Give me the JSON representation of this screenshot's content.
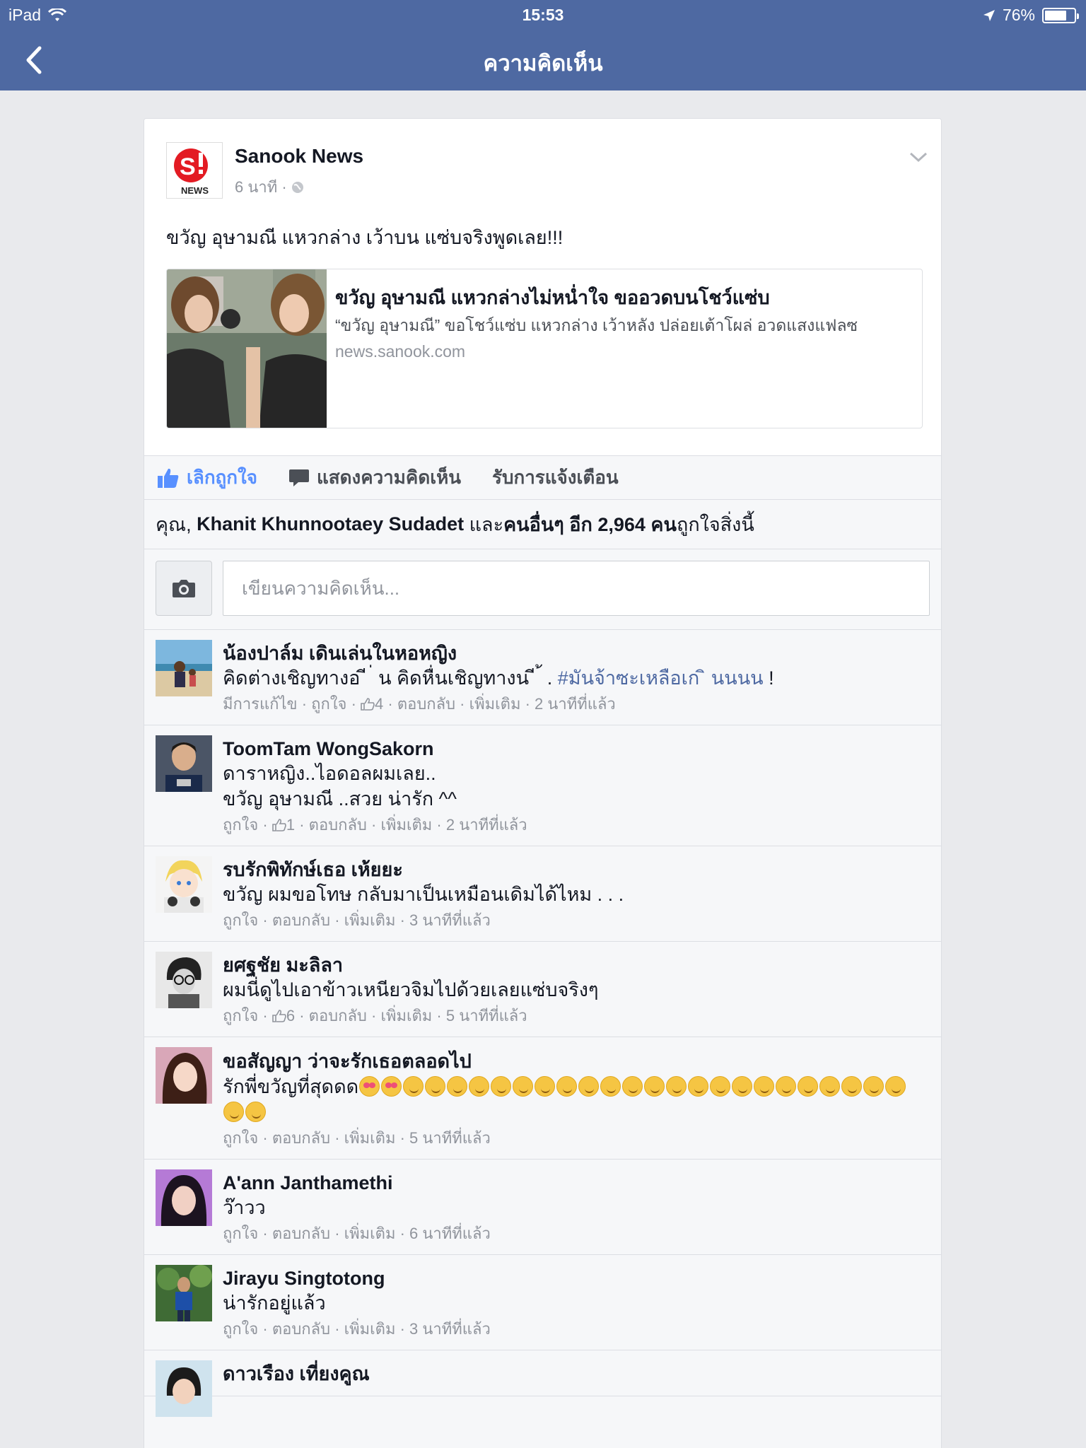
{
  "status_bar": {
    "device": "iPad",
    "time": "15:53",
    "battery": "76%",
    "battery_level": 0.76
  },
  "nav": {
    "title": "ความคิดเห็น"
  },
  "post": {
    "page_name": "Sanook News",
    "logo_text": "NEWS",
    "time": "6 นาที ·",
    "text": "ขวัญ อุษามณี แหวกล่าง เว้าบน แซ่บจริงพูดเลย!!!",
    "link": {
      "title": "ขวัญ อุษามณี แหวกล่างไม่หน่ำใจ ขออวดบนโชว์แซ่บ",
      "description": "“ขวัญ อุษามณี” ขอโชว์แซ่บ แหวกล่าง เว้าหลัง ปล่อยเต้าโผล่ อวดแสงแฟลซ",
      "domain": "news.sanook.com"
    }
  },
  "actions": {
    "like": "เลิกถูกใจ",
    "comment": "แสดงความคิดเห็น",
    "notify": "รับการแจ้งเตือน"
  },
  "likes": {
    "you": "คุณ,",
    "friend": "Khanit Khunnootaey Sudadet",
    "and": "และ",
    "others": "คนอื่นๆ อีก 2,964 คน",
    "suffix": "ถูกใจสิ่งนี้"
  },
  "composer": {
    "placeholder": "เขียนความคิดเห็น..."
  },
  "comments": [
    {
      "name": "น้องปาล์ม เดินเล่นในหอหญิง",
      "text": "คิดต่างเชิญทางอ ี ่ น คิดหื่นเชิญทางน ี ้ . ",
      "hashtag": "#มันจ้าซะเหลือเก ิ นนนน",
      "text_end": " !",
      "meta": [
        "มีการแก้ไข",
        "ถูกใจ",
        "4",
        "ตอบกลับ",
        "เพิ่มเติม",
        "2 นาทีที่แล้ว"
      ]
    },
    {
      "name": "ToomTam WongSakorn",
      "line1": "ดาราหญิง..ไอดอลผมเลย..",
      "line2": "ขวัญ อุษามณี ..สวย น่ารัก ^^",
      "meta": [
        "ถูกใจ",
        "1",
        "ตอบกลับ",
        "เพิ่มเติม",
        "2 นาทีที่แล้ว"
      ]
    },
    {
      "name": "รบรักพิทักษ์เธอ เห้ยยะ",
      "text": "ขวัญ ผมขอโทษ กลับมาเป็นเหมือนเดิมได้ไหม . . .",
      "meta": [
        "ถูกใจ",
        "ตอบกลับ",
        "เพิ่มเติม",
        "3 นาทีที่แล้ว"
      ]
    },
    {
      "name": "ยศฐชัย มะลิลา",
      "text": "ผมนี่ดูไปเอาข้าวเหนียวจิมไปด้วยเลยแซ่บจริงๆ",
      "meta": [
        "ถูกใจ",
        "6",
        "ตอบกลับ",
        "เพิ่มเติม",
        "5 นาทีที่แล้ว"
      ]
    },
    {
      "name": "ขอสัญญา ว่าจะรักเธอตลอดไป",
      "text": "รักพี่ขวัญที่สุดดด",
      "emoji_heart_count": 2,
      "emoji_smile_count": 25,
      "meta": [
        "ถูกใจ",
        "ตอบกลับ",
        "เพิ่มเติม",
        "5 นาทีที่แล้ว"
      ]
    },
    {
      "name": "A'ann Janthamethi",
      "text": "ว๊าวว",
      "meta": [
        "ถูกใจ",
        "ตอบกลับ",
        "เพิ่มเติม",
        "6 นาทีที่แล้ว"
      ]
    },
    {
      "name": "Jirayu Singtotong",
      "text": "น่ารักอยู่แล้ว",
      "meta": [
        "ถูกใจ",
        "ตอบกลับ",
        "เพิ่มเติม",
        "3 นาทีที่แล้ว"
      ]
    },
    {
      "name": "ดาวเรือง เที่ยงคูณ"
    }
  ],
  "colors": {
    "header": "#4e69a2",
    "liked": "#5890ff",
    "meta": "#90949c",
    "background": "#e9eaed"
  }
}
